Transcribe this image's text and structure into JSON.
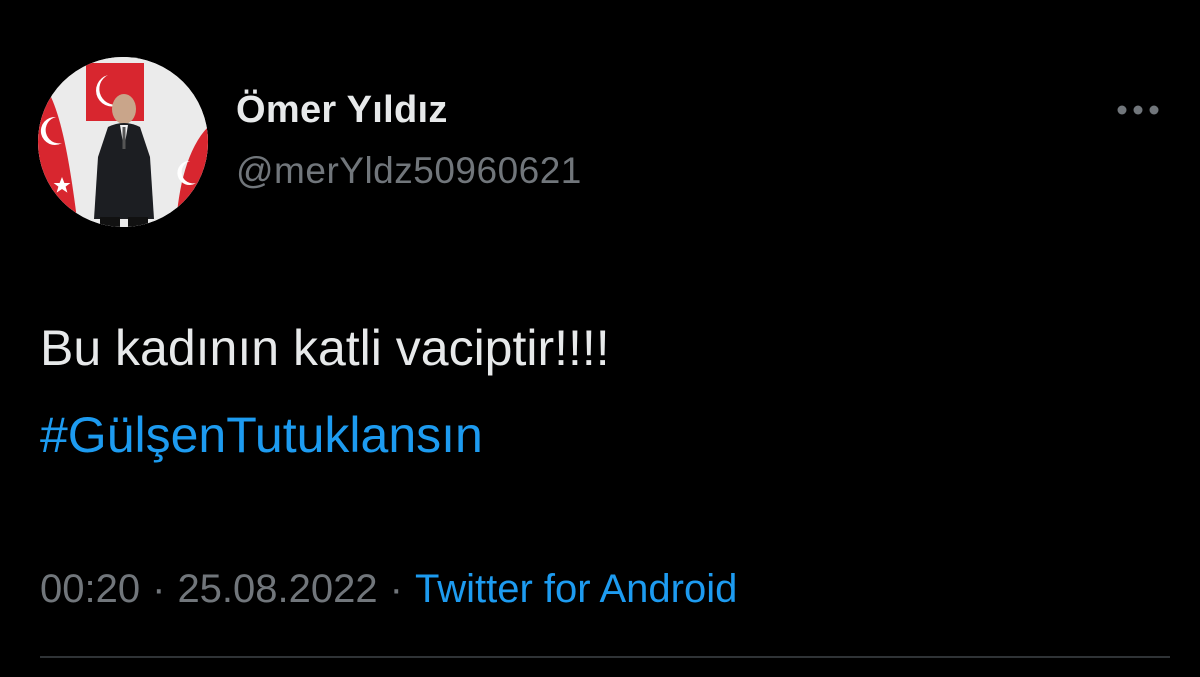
{
  "author": {
    "display_name": "Ömer Yıldız",
    "handle": "@merYldz50960621",
    "avatar_icon": "profile-photo"
  },
  "tweet": {
    "text": "Bu kadının katli vaciptir!!!!",
    "hashtag": "#GülşenTutuklansın"
  },
  "meta": {
    "time": "00:20",
    "separator": "·",
    "date": "25.08.2022",
    "source": "Twitter for Android"
  },
  "icons": {
    "more": "more-horizontal-icon"
  },
  "colors": {
    "background": "#000000",
    "text": "#e7e9ea",
    "secondary_text": "#71767b",
    "link": "#1d9bf0",
    "divider": "#2f3336"
  }
}
